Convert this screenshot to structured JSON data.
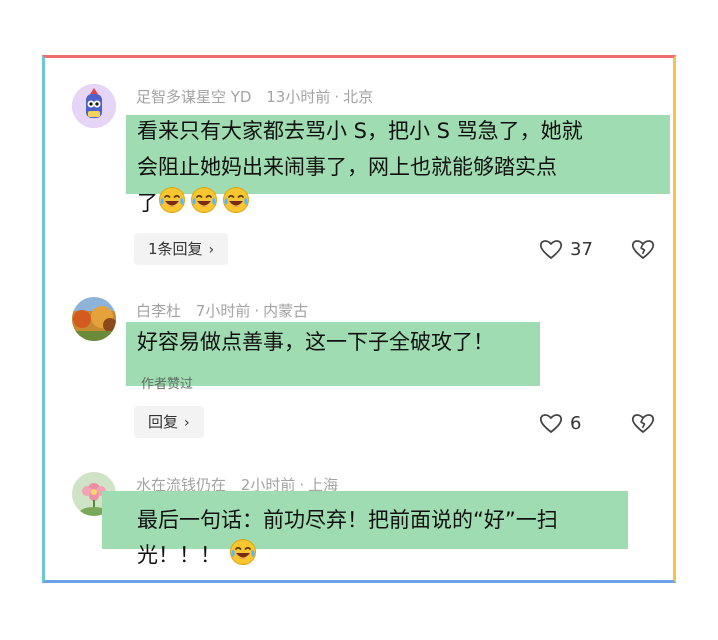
{
  "comments": [
    {
      "username": "足智多谋星空 YD",
      "time": "13小时前",
      "location": "北京",
      "lines": [
        "看来只有大家都去骂小 S，把小 S 骂急了，她就",
        "会阻止她妈出来闹事了，网上也就能够踏实点",
        "了"
      ],
      "emoji_count": 3,
      "reply_label": "1条回复",
      "likes": "37"
    },
    {
      "username": "白李杜",
      "time": "7小时前",
      "location": "内蒙古",
      "lines": [
        "好容易做点善事，这一下子全破攻了！"
      ],
      "author_liked": "作者赞过",
      "reply_label": "回复",
      "likes": "6"
    },
    {
      "username": "水在流钱仍在",
      "time": "2小时前",
      "location": "上海",
      "lines": [
        "最后一句话：前功尽弃！把前面说的“好”一扫",
        "光！！！"
      ],
      "emoji_count": 1
    }
  ],
  "icons": {
    "like": "heart-outline-icon",
    "dislike": "broken-heart-icon",
    "reply_chevron": "chevron-right-icon",
    "emoji": "tears-of-joy-emoji"
  },
  "colors": {
    "highlight": "#9fdcb1",
    "meta_text": "#a3a3a3",
    "frame_top": "#f06b6b",
    "frame_right": "#f5c24b",
    "frame_bottom": "#6aa3e8",
    "frame_left": "#6ac7d8"
  }
}
